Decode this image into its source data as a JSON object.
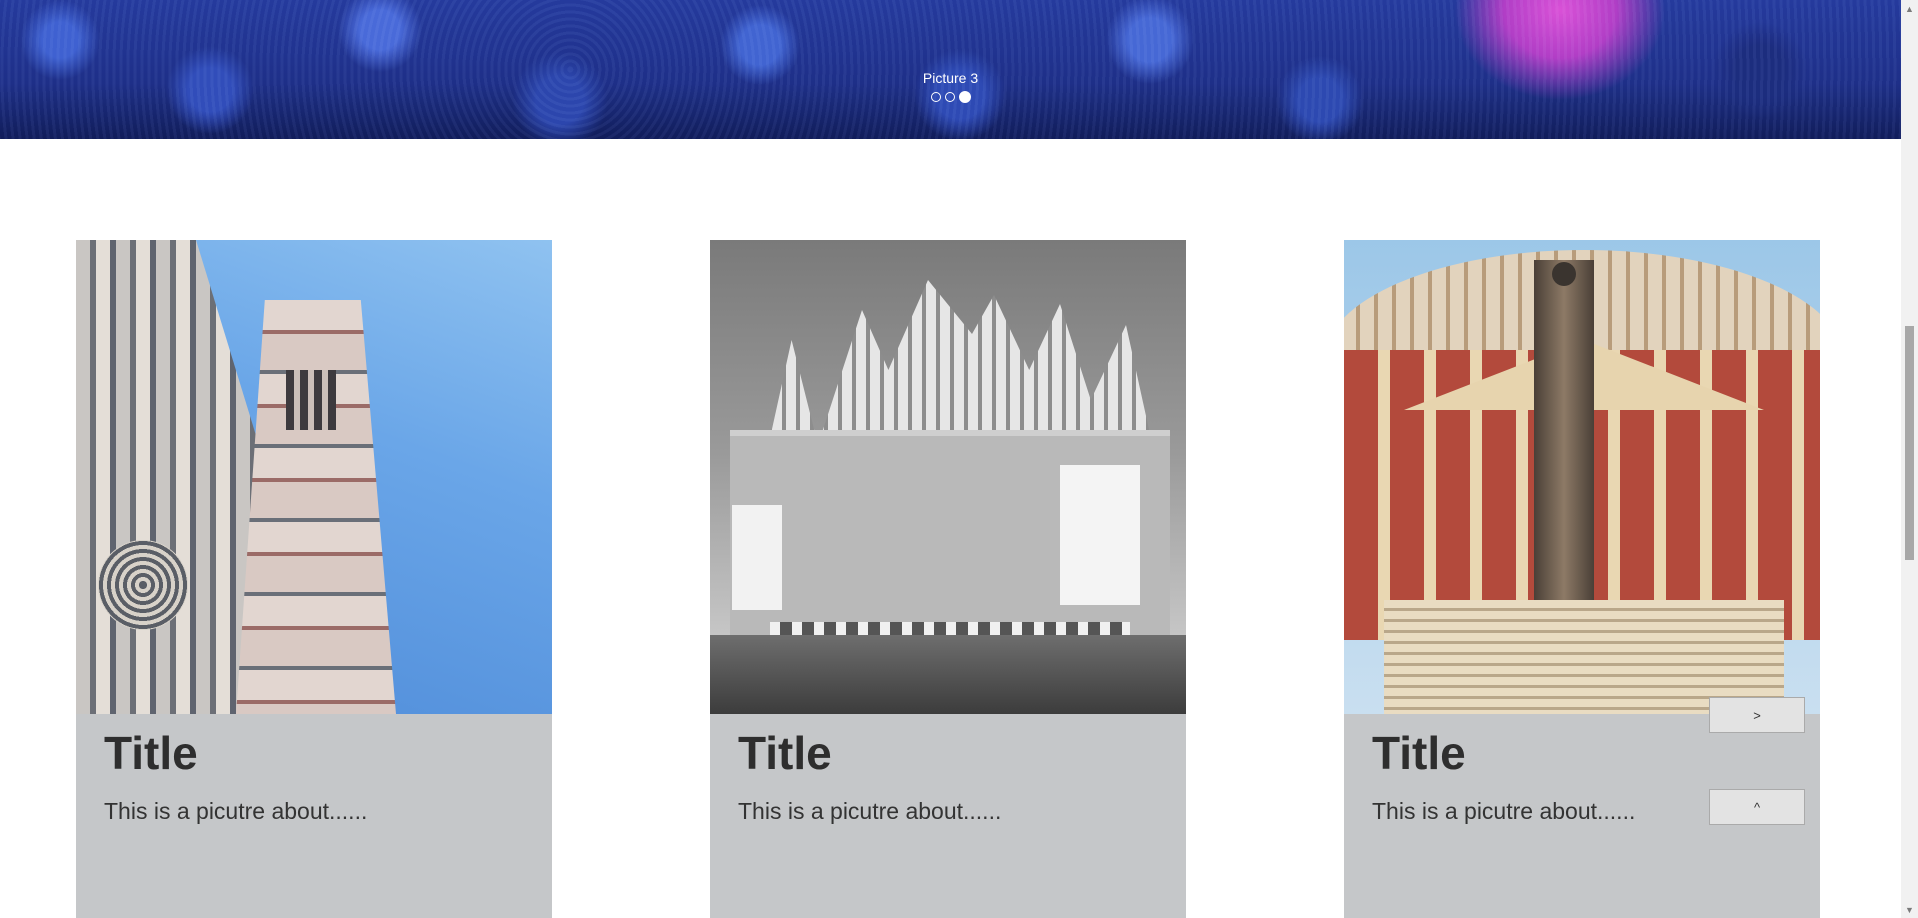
{
  "hero": {
    "caption": "Picture 3",
    "dots": [
      {
        "label": "slide 1",
        "active": false
      },
      {
        "label": "slide 2",
        "active": false
      },
      {
        "label": "slide 3",
        "active": true
      }
    ]
  },
  "cards": [
    {
      "title": "Title",
      "text": "This is a picutre about......",
      "image": "florence-cathedral-photo"
    },
    {
      "title": "Title",
      "text": "This is a picutre about......",
      "image": "milan-cathedral-photo"
    },
    {
      "title": "Title",
      "text": "This is a picutre about......",
      "image": "royal-albert-hall-photo"
    }
  ],
  "buttons": {
    "next_label": ">",
    "top_label": "^"
  },
  "scrollbar": {
    "up_icon": "chevron-up-icon",
    "down_icon": "chevron-down-icon"
  }
}
